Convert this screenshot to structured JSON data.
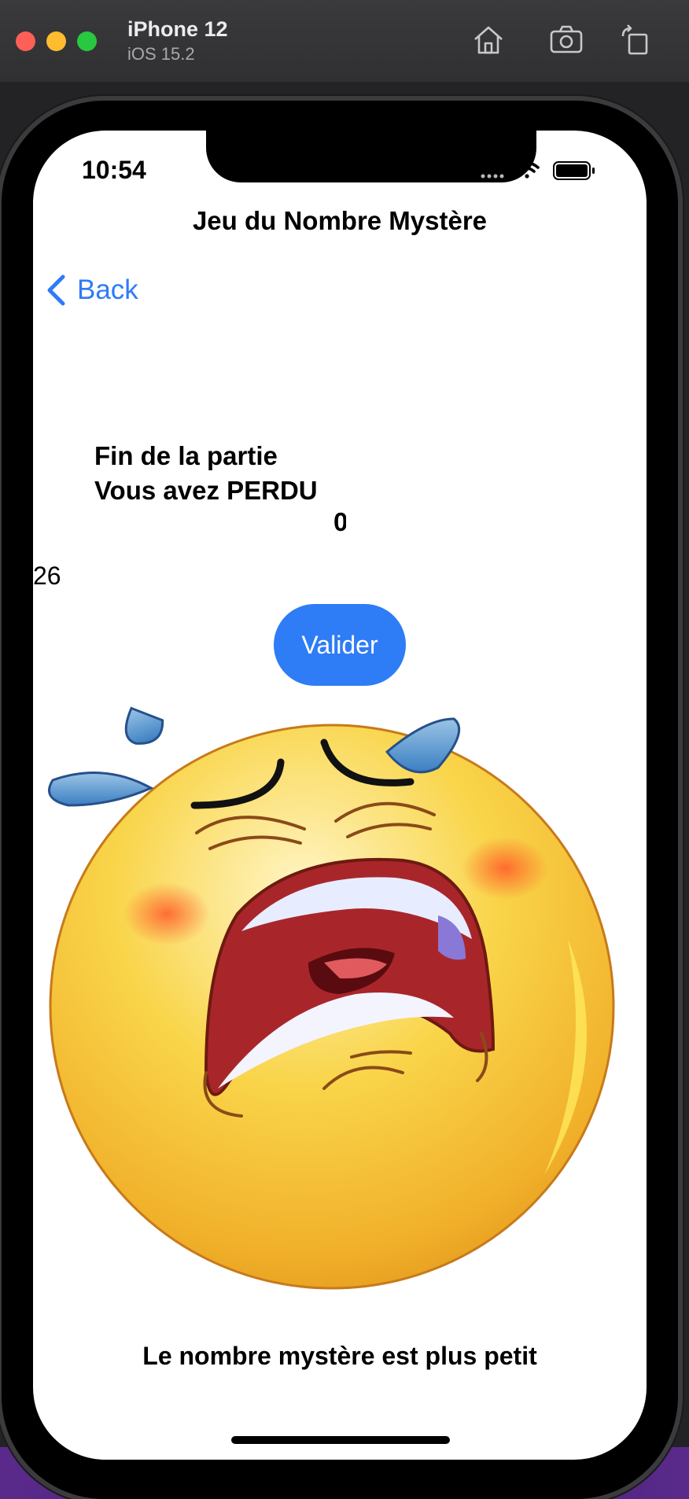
{
  "simulator": {
    "device": "iPhone 12",
    "os": "iOS 15.2",
    "icons": [
      "home-icon",
      "screenshot-icon",
      "rotate-icon"
    ]
  },
  "status_bar": {
    "time": "10:54",
    "icons": [
      "cellular-icon",
      "wifi-icon",
      "battery-icon"
    ]
  },
  "nav": {
    "title": "Jeu du Nombre Mystère",
    "back_label": "Back"
  },
  "content": {
    "line1": "Fin de la partie",
    "line2": "Vous avez PERDU",
    "cut_text": "0",
    "number_value": "26",
    "button_label": "Valider",
    "hint": "Le nombre mystère est plus petit"
  },
  "colors": {
    "accent": "#2e7cf6",
    "emoji_face": "#f7c43a"
  }
}
